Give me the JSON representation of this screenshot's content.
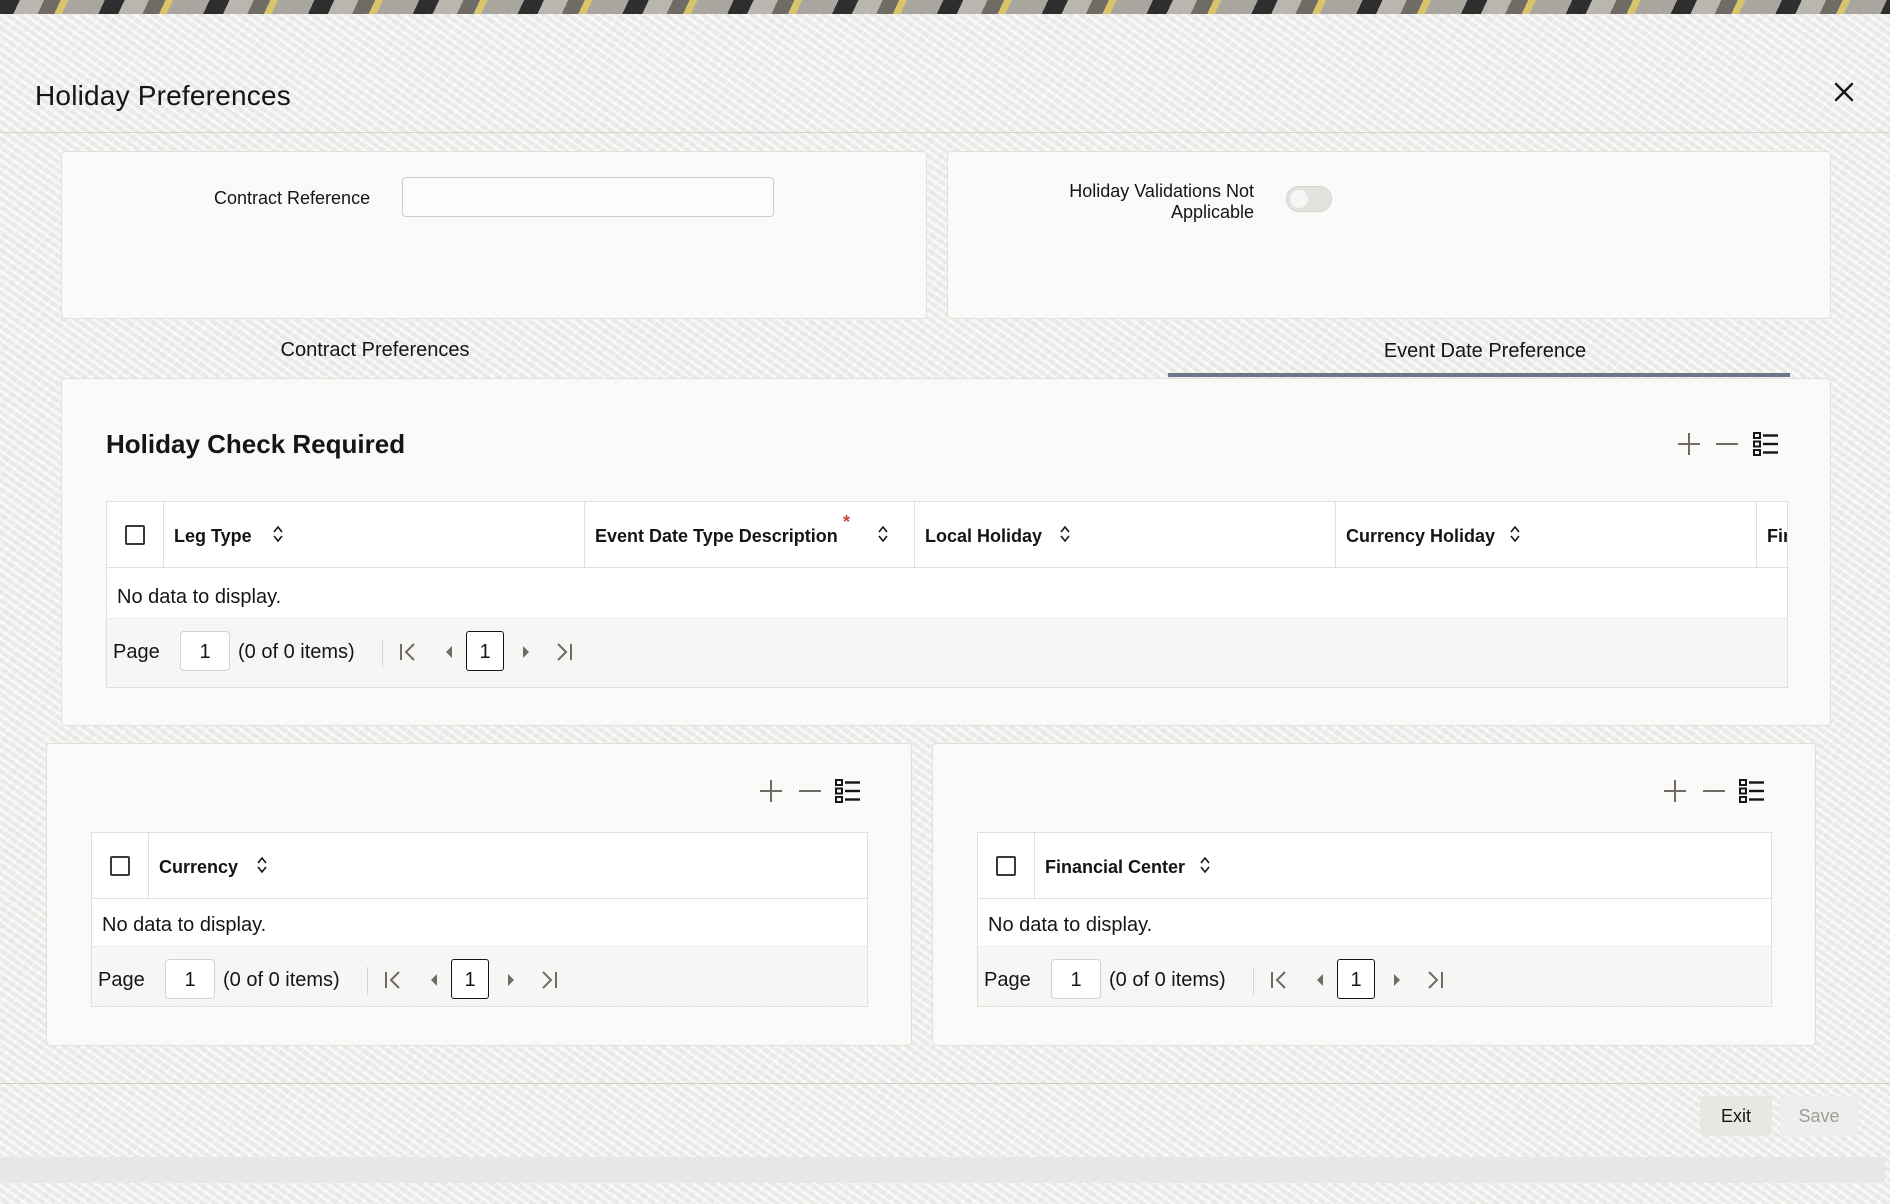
{
  "dialog": {
    "title": "Holiday Preferences"
  },
  "form": {
    "contract_reference_label": "Contract Reference",
    "contract_reference_value": "",
    "holiday_validations_label_line1": "Holiday Validations Not",
    "holiday_validations_label_line2": "Applicable",
    "holiday_validations_on": false
  },
  "tabs": [
    {
      "label": "Contract Preferences",
      "selected": false
    },
    {
      "label": "Event Date Preference",
      "selected": true
    }
  ],
  "holiday_check": {
    "title": "Holiday Check Required",
    "columns": [
      {
        "label": "Leg Type",
        "required": false
      },
      {
        "label": "Event Date Type Description",
        "required": true
      },
      {
        "label": "Local Holiday",
        "required": false
      },
      {
        "label": "Currency Holiday",
        "required": false
      },
      {
        "label": "Fir",
        "required": false
      }
    ],
    "required_marker": "*",
    "empty_text": "No data to display.",
    "pager": {
      "page_label": "Page",
      "page_value": "1",
      "count_text": "(0 of 0 items)",
      "current_page": "1"
    }
  },
  "currency_table": {
    "columns": [
      {
        "label": "Currency"
      }
    ],
    "empty_text": "No data to display.",
    "pager": {
      "page_label": "Page",
      "page_value": "1",
      "count_text": "(0 of 0 items)",
      "current_page": "1"
    }
  },
  "financial_center_table": {
    "columns": [
      {
        "label": "Financial Center"
      }
    ],
    "empty_text": "No data to display.",
    "pager": {
      "page_label": "Page",
      "page_value": "1",
      "count_text": "(0 of 0 items)",
      "current_page": "1"
    }
  },
  "footer": {
    "exit_label": "Exit",
    "save_label": "Save"
  },
  "colors": {
    "tab_indicator": "#6b7689",
    "required_marker": "#c74634",
    "text": "#161513"
  },
  "icons": [
    "close-icon",
    "add-icon",
    "remove-icon",
    "column-list-icon",
    "sort-icon",
    "first-page-icon",
    "previous-page-icon",
    "next-page-icon",
    "last-page-icon"
  ]
}
